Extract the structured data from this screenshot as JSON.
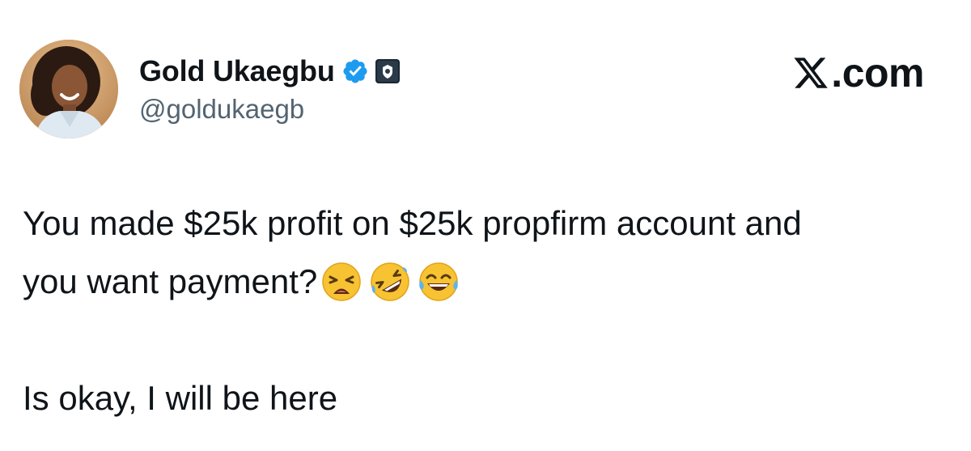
{
  "author": {
    "display_name": "Gold Ukaegbu",
    "handle": "@goldukaegb",
    "verified_badge_icon": "verified-check-icon",
    "affiliate_badge_icon": "affiliate-badge-icon",
    "colors": {
      "verified": "#1d9bf0",
      "handle": "#536471"
    }
  },
  "brand": {
    "logo_icon": "x-logo-icon",
    "text": ".com"
  },
  "tweet": {
    "line1": "You made $25k profit on $25k propfirm account and",
    "line2": "you want payment?",
    "line2_emojis": [
      "weary-face-emoji",
      "rolling-on-floor-laughing-emoji",
      "face-with-tears-of-joy-emoji"
    ],
    "line4": "Is okay, I will be here"
  }
}
